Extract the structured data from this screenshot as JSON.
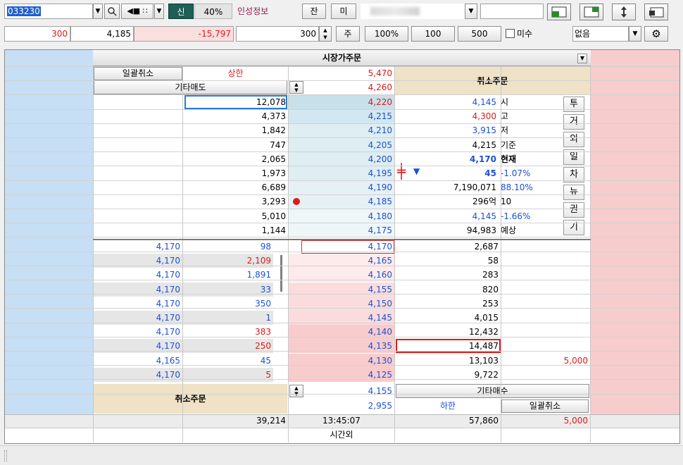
{
  "toolbar": {
    "code": "033230",
    "credit_label": "신",
    "margin_rate": "40%",
    "info_label": "인성정보",
    "balance_button": "잔",
    "unsettled_button": "미",
    "qty_down": "300",
    "price_input": "4,185",
    "diff_input": "-15,797",
    "order_qty": "300",
    "shares_button": "주",
    "pct_button": "100%",
    "btn_100": "100",
    "btn_500": "500",
    "misu_label": "미수",
    "select_value": "없음"
  },
  "panel": {
    "title": "시장가주문",
    "bulk_cancel_left": "일괄취소",
    "upper_limit": "상한",
    "upper_price": "5,470",
    "other_sell": "기타매도",
    "other_sell_price": "4,260",
    "cancel_order_top": "취소주문",
    "cancel_order_bottom": "취소주문",
    "other_buy": "기타매수",
    "other_buy_price": "4,155",
    "lower_limit": "하한",
    "bulk_cancel_right": "일괄취소",
    "lower_total": "2,955"
  },
  "asks": [
    {
      "qty": "12,078",
      "price": "4,220"
    },
    {
      "qty": "4,373",
      "price": "4,215"
    },
    {
      "qty": "1,842",
      "price": "4,210"
    },
    {
      "qty": "747",
      "price": "4,205"
    },
    {
      "qty": "2,065",
      "price": "4,200"
    },
    {
      "qty": "1,973",
      "price": "4,195"
    },
    {
      "qty": "6,689",
      "price": "4,190"
    },
    {
      "qty": "3,293",
      "price": "4,185"
    },
    {
      "qty": "5,010",
      "price": "4,180"
    },
    {
      "qty": "1,144",
      "price": "4,175"
    }
  ],
  "bids": [
    {
      "price": "4,170",
      "qty": "2,687",
      "order": ""
    },
    {
      "price": "4,165",
      "qty": "58",
      "order": ""
    },
    {
      "price": "4,160",
      "qty": "283",
      "order": ""
    },
    {
      "price": "4,155",
      "qty": "820",
      "order": ""
    },
    {
      "price": "4,150",
      "qty": "253",
      "order": ""
    },
    {
      "price": "4,145",
      "qty": "4,015",
      "order": ""
    },
    {
      "price": "4,140",
      "qty": "12,432",
      "order": ""
    },
    {
      "price": "4,135",
      "qty": "14,487",
      "order": ""
    },
    {
      "price": "4,130",
      "qty": "13,103",
      "order": "5,000"
    },
    {
      "price": "4,125",
      "qty": "9,722",
      "order": ""
    }
  ],
  "ticks": [
    {
      "price": "4,170",
      "vol": "98",
      "color": "blue"
    },
    {
      "price": "4,170",
      "vol": "2,109",
      "color": "red"
    },
    {
      "price": "4,170",
      "vol": "1,891",
      "color": "blue"
    },
    {
      "price": "4,170",
      "vol": "33",
      "color": "blue"
    },
    {
      "price": "4,170",
      "vol": "350",
      "color": "blue"
    },
    {
      "price": "4,170",
      "vol": "1",
      "color": "blue"
    },
    {
      "price": "4,170",
      "vol": "383",
      "color": "red"
    },
    {
      "price": "4,170",
      "vol": "250",
      "color": "red"
    },
    {
      "price": "4,165",
      "vol": "45",
      "color": "blue"
    },
    {
      "price": "4,170",
      "vol": "5",
      "color": "red"
    }
  ],
  "info": {
    "open": "4,145",
    "open_label": "시",
    "high": "4,300",
    "high_label": "고",
    "low": "3,915",
    "low_label": "저",
    "base": "4,215",
    "base_label": "기준",
    "current": "4,170",
    "current_label": "현재",
    "change": "45",
    "change_pct": "-1.07%",
    "volume": "7,190,071",
    "volume_pct": "88.10%",
    "amount": "296억",
    "amount_extra": "10",
    "expected_price": "4,145",
    "expected_pct": "-1.66%",
    "expected_vol": "94,983",
    "expected_label": "예상"
  },
  "side_tabs": [
    "투",
    "거",
    "외",
    "일",
    "차",
    "뉴",
    "권",
    "기"
  ],
  "totals": {
    "ask_total": "39,214",
    "time": "13:45:07",
    "bid_total": "57,860",
    "order_total": "5,000",
    "after_hours": "시간외"
  },
  "colors": {
    "ask_bg": "#dbecf6",
    "bid_bg": "#fbdcdc",
    "side_blue": "#c6dff4",
    "side_red": "#f6cccc",
    "cancel_bg": "#efe2c6"
  }
}
